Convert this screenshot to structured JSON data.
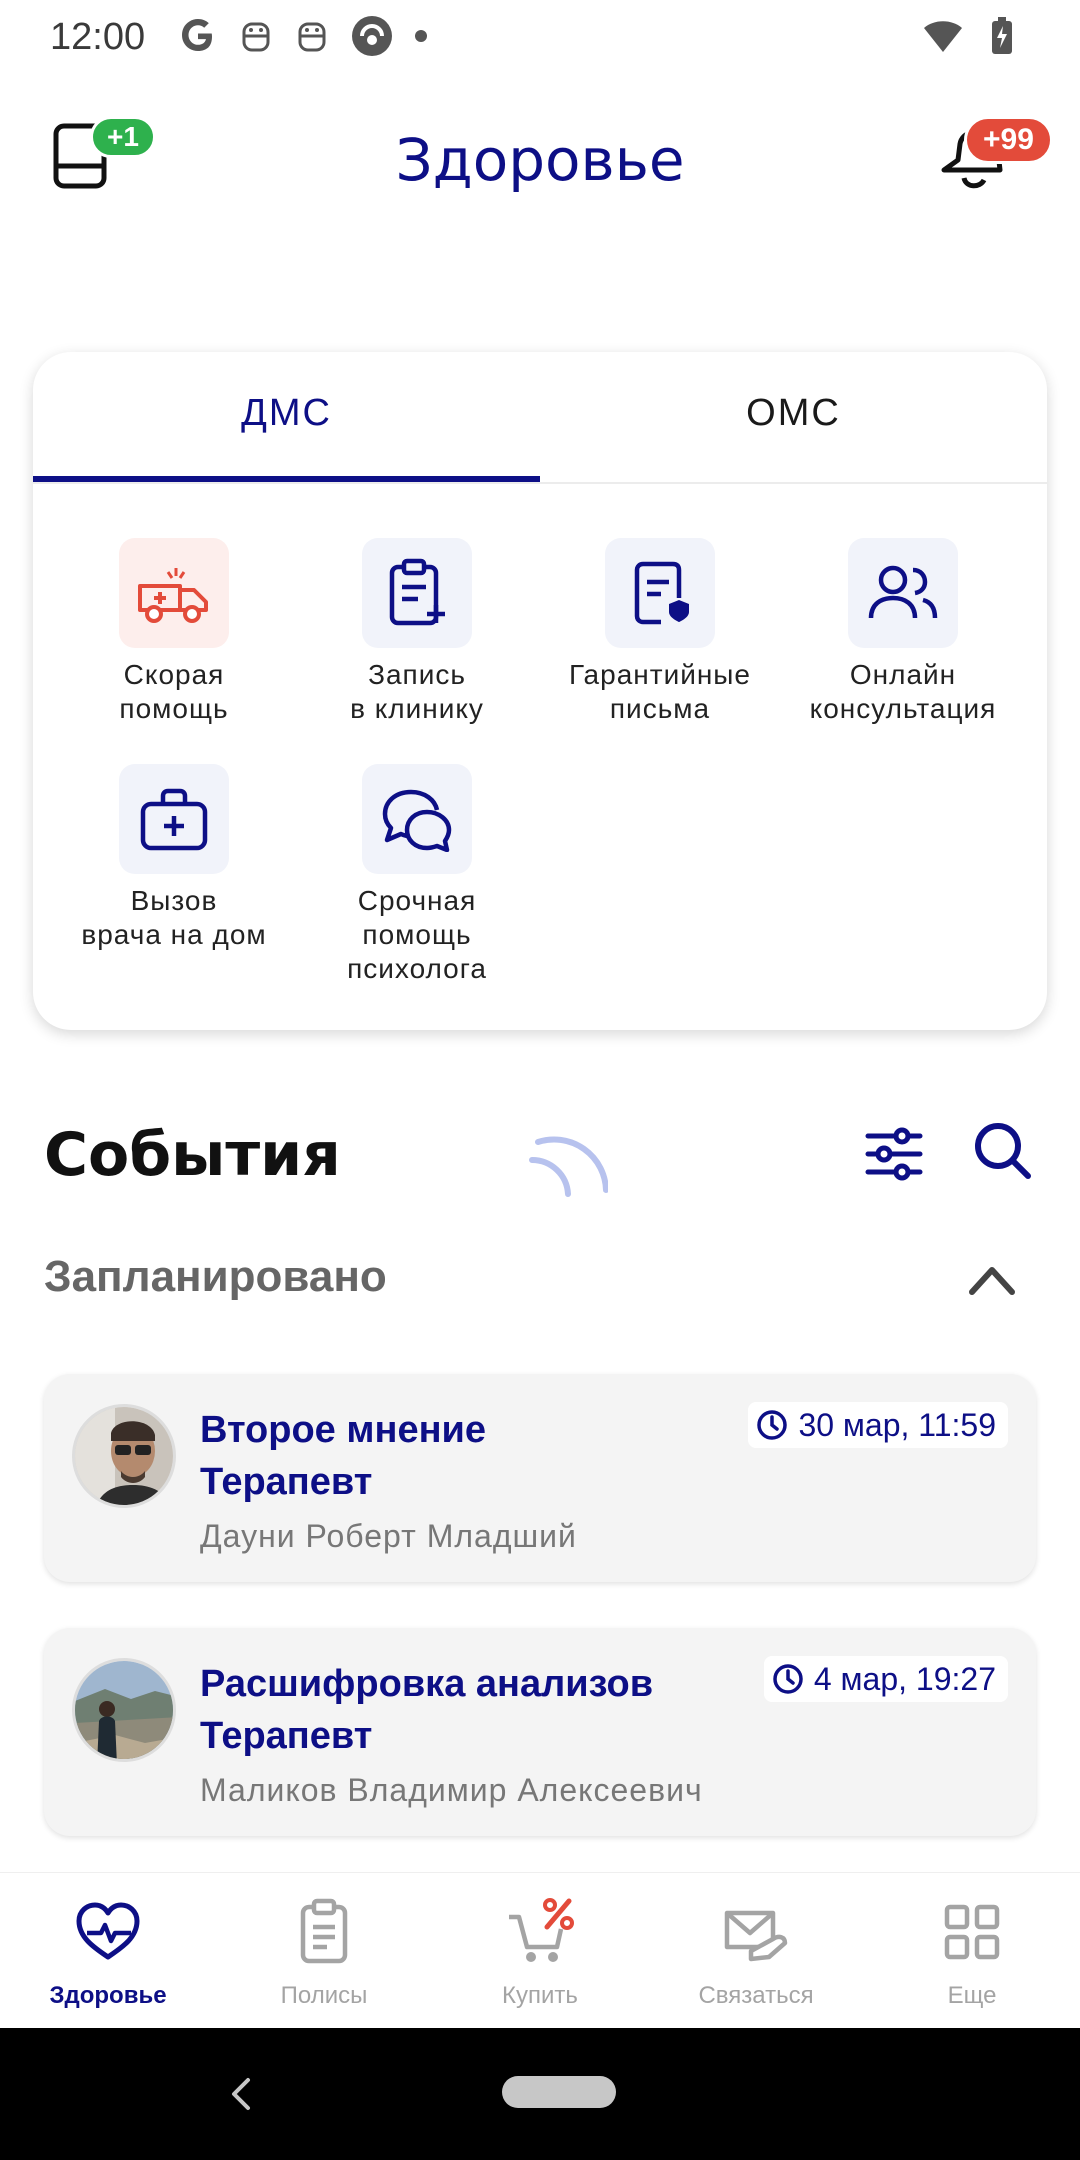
{
  "status_bar": {
    "time": "12:00"
  },
  "header": {
    "title": "Здоровье",
    "wallet_badge": "+1",
    "notifications_badge": "+99"
  },
  "tabs": [
    {
      "label": "ДМС",
      "active": true
    },
    {
      "label": "ОМС",
      "active": false
    }
  ],
  "services": [
    {
      "label": "Скорая\nпомощь",
      "icon": "ambulance-icon"
    },
    {
      "label": "Запись\nв клинику",
      "icon": "clinic-appointment-icon"
    },
    {
      "label": "Гарантийные\nписьма",
      "icon": "guarantee-letter-icon"
    },
    {
      "label": "Онлайн\nконсультация",
      "icon": "online-consultation-icon"
    },
    {
      "label": "Вызов\nврача на дом",
      "icon": "medical-bag-icon"
    },
    {
      "label": "Срочная\nпомощь\nпсихолога",
      "icon": "chat-bubbles-icon"
    }
  ],
  "events": {
    "title": "События",
    "section": "Запланировано",
    "items": [
      {
        "title": "Второе мнение\nТерапевт",
        "doctor": "Дауни Роберт Младший",
        "time": "30 мар, 11:59"
      },
      {
        "title": "Расшифровка анализов\nТерапевт",
        "doctor": "Маликов Владимир Алексеевич",
        "time": "4 мар, 19:27"
      }
    ]
  },
  "bottom_nav": [
    {
      "label": "Здоровье",
      "icon": "heart-pulse-icon",
      "active": true
    },
    {
      "label": "Полисы",
      "icon": "clipboard-icon",
      "active": false
    },
    {
      "label": "Купить",
      "icon": "cart-percent-icon",
      "active": false
    },
    {
      "label": "Связаться",
      "icon": "envelope-hand-icon",
      "active": false
    },
    {
      "label": "Еще",
      "icon": "grid-icon",
      "active": false
    }
  ],
  "colors": {
    "brand": "#0d0f86",
    "green_badge": "#2eb14d",
    "red_badge": "#e34b3a",
    "ambulance": "#e34b3a"
  }
}
